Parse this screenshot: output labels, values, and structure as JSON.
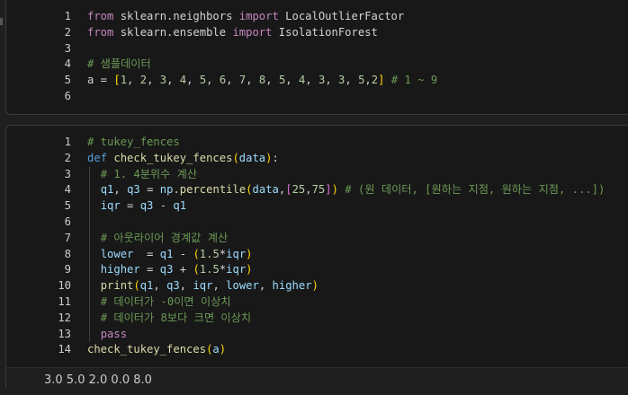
{
  "cell1": {
    "lines": [
      {
        "n": "1",
        "parts": [
          [
            "kw",
            "from"
          ],
          [
            "plain",
            " sklearn.neighbors "
          ],
          [
            "kw",
            "import"
          ],
          [
            "plain",
            " LocalOutlierFactor"
          ]
        ]
      },
      {
        "n": "2",
        "parts": [
          [
            "kw",
            "from"
          ],
          [
            "plain",
            " sklearn.ensemble "
          ],
          [
            "kw",
            "import"
          ],
          [
            "plain",
            " IsolationForest"
          ]
        ]
      },
      {
        "n": "3",
        "parts": []
      },
      {
        "n": "4",
        "parts": [
          [
            "cm",
            "# 샘플데이터"
          ]
        ]
      },
      {
        "n": "5",
        "parts": [
          [
            "plain",
            "a = "
          ],
          [
            "br",
            "["
          ],
          [
            "num",
            "1"
          ],
          [
            "plain",
            ", "
          ],
          [
            "num",
            "2"
          ],
          [
            "plain",
            ", "
          ],
          [
            "num",
            "3"
          ],
          [
            "plain",
            ", "
          ],
          [
            "num",
            "4"
          ],
          [
            "plain",
            ", "
          ],
          [
            "num",
            "5"
          ],
          [
            "plain",
            ", "
          ],
          [
            "num",
            "6"
          ],
          [
            "plain",
            ", "
          ],
          [
            "num",
            "7"
          ],
          [
            "plain",
            ", "
          ],
          [
            "num",
            "8"
          ],
          [
            "plain",
            ", "
          ],
          [
            "num",
            "5"
          ],
          [
            "plain",
            ", "
          ],
          [
            "num",
            "4"
          ],
          [
            "plain",
            ", "
          ],
          [
            "num",
            "3"
          ],
          [
            "plain",
            ", "
          ],
          [
            "num",
            "3"
          ],
          [
            "plain",
            ", "
          ],
          [
            "num",
            "5"
          ],
          [
            "plain",
            ","
          ],
          [
            "num",
            "2"
          ],
          [
            "br",
            "]"
          ],
          [
            "cm",
            " # 1 ~ 9"
          ]
        ]
      },
      {
        "n": "6",
        "parts": []
      }
    ]
  },
  "cell2": {
    "lines": [
      {
        "n": "1",
        "parts": [
          [
            "cm",
            "# tukey_fences"
          ]
        ]
      },
      {
        "n": "2",
        "parts": [
          [
            "kw2",
            "def"
          ],
          [
            "plain",
            " "
          ],
          [
            "fn",
            "check_tukey_fences"
          ],
          [
            "br",
            "("
          ],
          [
            "var",
            "data"
          ],
          [
            "br",
            ")"
          ],
          [
            "plain",
            ":"
          ]
        ]
      },
      {
        "n": "3",
        "parts": [
          [
            "plain",
            "  "
          ],
          [
            "cm",
            "# 1. 4분위수 계산"
          ]
        ]
      },
      {
        "n": "4",
        "parts": [
          [
            "plain",
            "  "
          ],
          [
            "var",
            "q1"
          ],
          [
            "plain",
            ", "
          ],
          [
            "var",
            "q3"
          ],
          [
            "plain",
            " = "
          ],
          [
            "var",
            "np"
          ],
          [
            "plain",
            "."
          ],
          [
            "fn",
            "percentile"
          ],
          [
            "br",
            "("
          ],
          [
            "var",
            "data"
          ],
          [
            "plain",
            ","
          ],
          [
            "br2",
            "["
          ],
          [
            "num",
            "25"
          ],
          [
            "plain",
            ","
          ],
          [
            "num",
            "75"
          ],
          [
            "br2",
            "]"
          ],
          [
            "br",
            ")"
          ],
          [
            "cm",
            " # (원 데이터, [원하는 지점, 원하는 지점, ...])"
          ]
        ]
      },
      {
        "n": "5",
        "parts": [
          [
            "plain",
            "  "
          ],
          [
            "var",
            "iqr"
          ],
          [
            "plain",
            " = "
          ],
          [
            "var",
            "q3"
          ],
          [
            "plain",
            " - "
          ],
          [
            "var",
            "q1"
          ]
        ]
      },
      {
        "n": "6",
        "parts": []
      },
      {
        "n": "7",
        "parts": [
          [
            "plain",
            "  "
          ],
          [
            "cm",
            "# 아웃라이어 경계값 계산"
          ]
        ]
      },
      {
        "n": "8",
        "parts": [
          [
            "plain",
            "  "
          ],
          [
            "var",
            "lower"
          ],
          [
            "plain",
            "  = "
          ],
          [
            "var",
            "q1"
          ],
          [
            "plain",
            " - "
          ],
          [
            "br",
            "("
          ],
          [
            "num",
            "1.5"
          ],
          [
            "plain",
            "*"
          ],
          [
            "var",
            "iqr"
          ],
          [
            "br",
            ")"
          ]
        ]
      },
      {
        "n": "9",
        "parts": [
          [
            "plain",
            "  "
          ],
          [
            "var",
            "higher"
          ],
          [
            "plain",
            " = "
          ],
          [
            "var",
            "q3"
          ],
          [
            "plain",
            " + "
          ],
          [
            "br",
            "("
          ],
          [
            "num",
            "1.5"
          ],
          [
            "plain",
            "*"
          ],
          [
            "var",
            "iqr"
          ],
          [
            "br",
            ")"
          ]
        ]
      },
      {
        "n": "10",
        "parts": [
          [
            "plain",
            "  "
          ],
          [
            "fn",
            "print"
          ],
          [
            "br",
            "("
          ],
          [
            "var",
            "q1"
          ],
          [
            "plain",
            ", "
          ],
          [
            "var",
            "q3"
          ],
          [
            "plain",
            ", "
          ],
          [
            "var",
            "iqr"
          ],
          [
            "plain",
            ", "
          ],
          [
            "var",
            "lower"
          ],
          [
            "plain",
            ", "
          ],
          [
            "var",
            "higher"
          ],
          [
            "br",
            ")"
          ]
        ]
      },
      {
        "n": "11",
        "parts": [
          [
            "plain",
            "  "
          ],
          [
            "cm",
            "# 데이터가 -0이면 이상치"
          ]
        ]
      },
      {
        "n": "12",
        "parts": [
          [
            "plain",
            "  "
          ],
          [
            "cm",
            "# 데이터가 8보다 크면 이상치"
          ]
        ]
      },
      {
        "n": "13",
        "parts": [
          [
            "plain",
            "  "
          ],
          [
            "kw",
            "pass"
          ]
        ]
      },
      {
        "n": "14",
        "parts": [
          [
            "fn",
            "check_tukey_fences"
          ],
          [
            "br",
            "("
          ],
          [
            "var",
            "a"
          ],
          [
            "br",
            ")"
          ]
        ]
      }
    ],
    "output": "3.0 5.0 2.0 0.0 8.0"
  }
}
